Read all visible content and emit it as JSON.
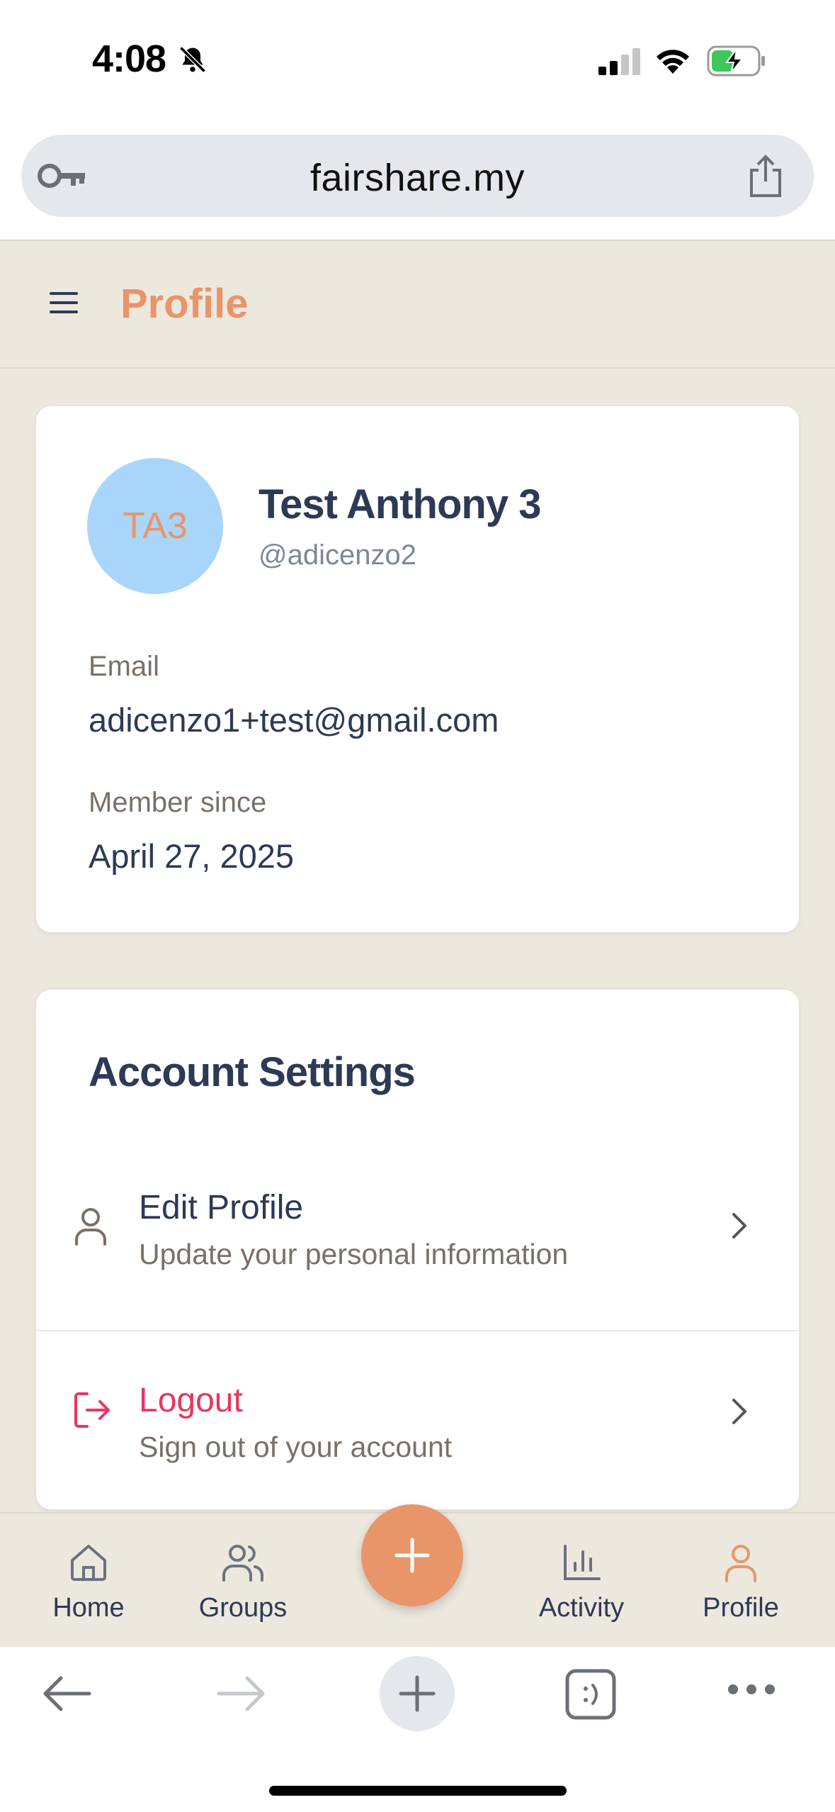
{
  "status_bar": {
    "time": "4:08"
  },
  "browser": {
    "url": "fairshare.my"
  },
  "header": {
    "title": "Profile"
  },
  "profile": {
    "initials": "TA3",
    "name": "Test Anthony 3",
    "username": "@adicenzo2",
    "email_label": "Email",
    "email": "adicenzo1+test@gmail.com",
    "member_since_label": "Member since",
    "member_since": "April 27, 2025"
  },
  "settings": {
    "title": "Account Settings",
    "items": [
      {
        "title": "Edit Profile",
        "subtitle": "Update your personal information",
        "icon": "user-icon"
      },
      {
        "title": "Logout",
        "subtitle": "Sign out of your account",
        "icon": "logout-icon"
      }
    ]
  },
  "bottom_nav": {
    "items": [
      {
        "label": "Home",
        "icon": "home-icon"
      },
      {
        "label": "Groups",
        "icon": "groups-icon"
      },
      {
        "label": "Activity",
        "icon": "activity-icon"
      },
      {
        "label": "Profile",
        "icon": "profile-icon"
      }
    ],
    "active": "Profile"
  },
  "colors": {
    "accent": "#e8956a",
    "avatar_bg": "#a9d5fb",
    "danger": "#e8365d",
    "text_primary": "#2d3a55",
    "background": "#ede8de"
  }
}
